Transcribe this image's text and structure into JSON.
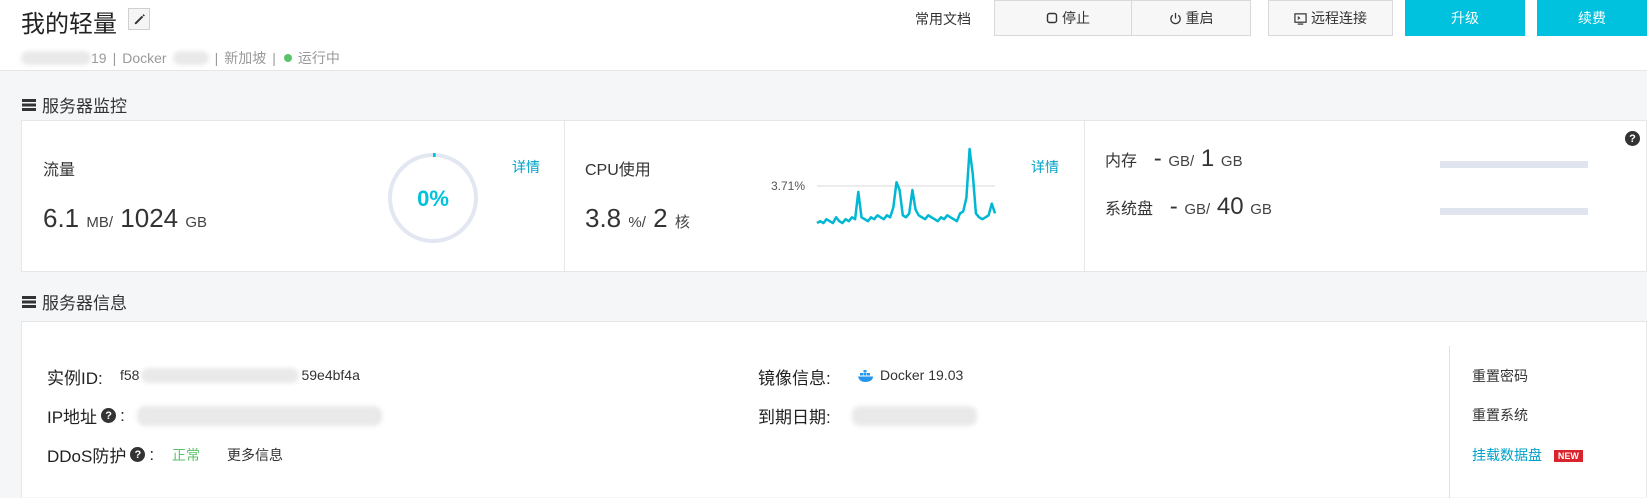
{
  "header": {
    "title": "我的轻量",
    "sub": {
      "id_suffix": "19",
      "sep1": "|",
      "image_prefix": "Docker",
      "sep2": "|",
      "region": "新加坡",
      "sep3": "|",
      "status": "运行中",
      "status_color": "#5cc26a"
    },
    "doc_link": "常用文档",
    "buttons": {
      "stop": "停止",
      "restart": "重启",
      "remote": "远程连接",
      "upgrade": "升级",
      "renew": "续费"
    },
    "accent": "#00c1de"
  },
  "monitor": {
    "section_title": "服务器监控",
    "traffic": {
      "label": "流量",
      "used": "6.1",
      "used_unit": "MB",
      "slash": "/",
      "total": "1024",
      "total_unit": "GB",
      "percent_text": "0%",
      "percent": 0.01,
      "detail": "详情"
    },
    "cpu": {
      "label": "CPU使用",
      "value": "3.8",
      "value_unit": "%",
      "slash": "/",
      "cores": "2",
      "cores_unit": "核",
      "peak_label": "3.71%",
      "detail": "详情"
    },
    "memory": {
      "label": "内存",
      "used": "-",
      "used_unit": "GB",
      "slash": "/",
      "total": "1",
      "total_unit": "GB",
      "fill": 0
    },
    "disk": {
      "label": "系统盘",
      "used": "-",
      "used_unit": "GB",
      "slash": "/",
      "total": "40",
      "total_unit": "GB",
      "fill": 0
    },
    "help": "?"
  },
  "chart_data": {
    "type": "line",
    "title": "",
    "xlabel": "",
    "ylabel": "",
    "annotations": [
      "3.71%"
    ],
    "series": [
      {
        "color": "#00b8d4",
        "values": [
          0.3,
          0.4,
          0.3,
          0.5,
          0.4,
          0.3,
          0.6,
          0.4,
          0.3,
          0.5,
          0.4,
          0.6,
          0.5,
          1.9,
          0.6,
          0.5,
          0.4,
          0.6,
          0.5,
          0.7,
          0.6,
          0.5,
          0.7,
          0.6,
          1.1,
          2.4,
          2.0,
          0.7,
          0.6,
          0.8,
          2.0,
          1.0,
          0.7,
          0.6,
          0.5,
          0.7,
          0.6,
          0.5,
          0.4,
          0.6,
          0.5,
          0.7,
          0.6,
          0.5,
          0.4,
          0.8,
          0.9,
          1.6,
          4.1,
          2.8,
          0.8,
          0.6,
          0.5,
          0.6,
          0.7,
          1.3,
          0.8
        ]
      }
    ]
  },
  "info": {
    "section_title": "服务器信息",
    "instance_label": "实例ID:",
    "instance_prefix": "f58",
    "instance_suffix": "59e4bf4a",
    "ip_label": "IP地址",
    "ip_colon": ":",
    "ddos_label": "DDoS防护",
    "ddos_colon": ":",
    "ddos_status": "正常",
    "ddos_status_color": "#5cc26a",
    "ddos_more": "更多信息",
    "image_label": "镜像信息:",
    "image_value": "Docker 19.03",
    "expire_label": "到期日期:",
    "actions": {
      "reset_password": "重置密码",
      "reset_system": "重置系统",
      "mount_disk": "挂载数据盘",
      "new_badge": "NEW"
    }
  }
}
